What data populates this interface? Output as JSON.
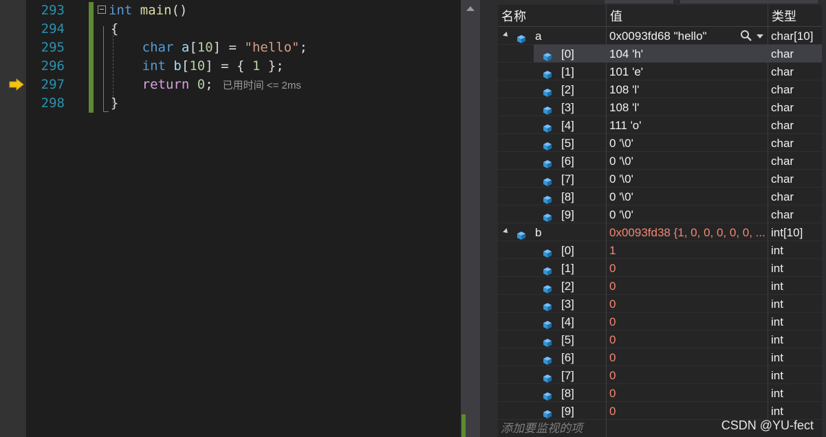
{
  "editor": {
    "line_numbers": [
      "293",
      "294",
      "295",
      "296",
      "297",
      "298"
    ],
    "lines": {
      "l293": {
        "kw": "int",
        "fn": "main",
        "rest": "()"
      },
      "l294": {
        "text": "{"
      },
      "l295": {
        "kw": "char",
        "var": "a",
        "open": "[",
        "num": "10",
        "mid": "] = ",
        "str": "\"hello\"",
        "end": ";"
      },
      "l296": {
        "kw": "int",
        "var": "b",
        "open": "[",
        "num": "10",
        "mid": "] = { ",
        "num2": "1",
        "end": " };"
      },
      "l297": {
        "kw": "return",
        "num": "0",
        "end": ";",
        "perf_tip": "已用时间 <= 2ms"
      },
      "l298": {
        "text": "}"
      }
    },
    "current_line": "297",
    "change_bar_color": "#5d8a32"
  },
  "watch": {
    "headers": {
      "name": "名称",
      "value": "值",
      "type": "类型"
    },
    "rows": [
      {
        "name": "a",
        "value": "0x0093fd68 \"hello\"",
        "type": "char[10]",
        "level": 0,
        "expanded": true,
        "changed": false
      },
      {
        "name": "[0]",
        "value": "104 'h'",
        "type": "char",
        "level": 1,
        "changed": false,
        "selected": true
      },
      {
        "name": "[1]",
        "value": "101 'e'",
        "type": "char",
        "level": 1,
        "changed": false
      },
      {
        "name": "[2]",
        "value": "108 'l'",
        "type": "char",
        "level": 1,
        "changed": false
      },
      {
        "name": "[3]",
        "value": "108 'l'",
        "type": "char",
        "level": 1,
        "changed": false
      },
      {
        "name": "[4]",
        "value": "111 'o'",
        "type": "char",
        "level": 1,
        "changed": false
      },
      {
        "name": "[5]",
        "value": "0 '\\0'",
        "type": "char",
        "level": 1,
        "changed": false
      },
      {
        "name": "[6]",
        "value": "0 '\\0'",
        "type": "char",
        "level": 1,
        "changed": false
      },
      {
        "name": "[7]",
        "value": "0 '\\0'",
        "type": "char",
        "level": 1,
        "changed": false
      },
      {
        "name": "[8]",
        "value": "0 '\\0'",
        "type": "char",
        "level": 1,
        "changed": false
      },
      {
        "name": "[9]",
        "value": "0 '\\0'",
        "type": "char",
        "level": 1,
        "changed": false
      },
      {
        "name": "b",
        "value": "0x0093fd38 {1, 0, 0, 0, 0, 0, ...",
        "type": "int[10]",
        "level": 0,
        "expanded": true,
        "changed": true
      },
      {
        "name": "[0]",
        "value": "1",
        "type": "int",
        "level": 1,
        "changed": true
      },
      {
        "name": "[1]",
        "value": "0",
        "type": "int",
        "level": 1,
        "changed": true
      },
      {
        "name": "[2]",
        "value": "0",
        "type": "int",
        "level": 1,
        "changed": true
      },
      {
        "name": "[3]",
        "value": "0",
        "type": "int",
        "level": 1,
        "changed": true
      },
      {
        "name": "[4]",
        "value": "0",
        "type": "int",
        "level": 1,
        "changed": true
      },
      {
        "name": "[5]",
        "value": "0",
        "type": "int",
        "level": 1,
        "changed": true
      },
      {
        "name": "[6]",
        "value": "0",
        "type": "int",
        "level": 1,
        "changed": true
      },
      {
        "name": "[7]",
        "value": "0",
        "type": "int",
        "level": 1,
        "changed": true
      },
      {
        "name": "[8]",
        "value": "0",
        "type": "int",
        "level": 1,
        "changed": true
      },
      {
        "name": "[9]",
        "value": "0",
        "type": "int",
        "level": 1,
        "changed": true
      }
    ],
    "add_watch_placeholder": "添加要监视的项",
    "changed_color": "#f48771"
  },
  "watermark": "CSDN @YU-fect"
}
